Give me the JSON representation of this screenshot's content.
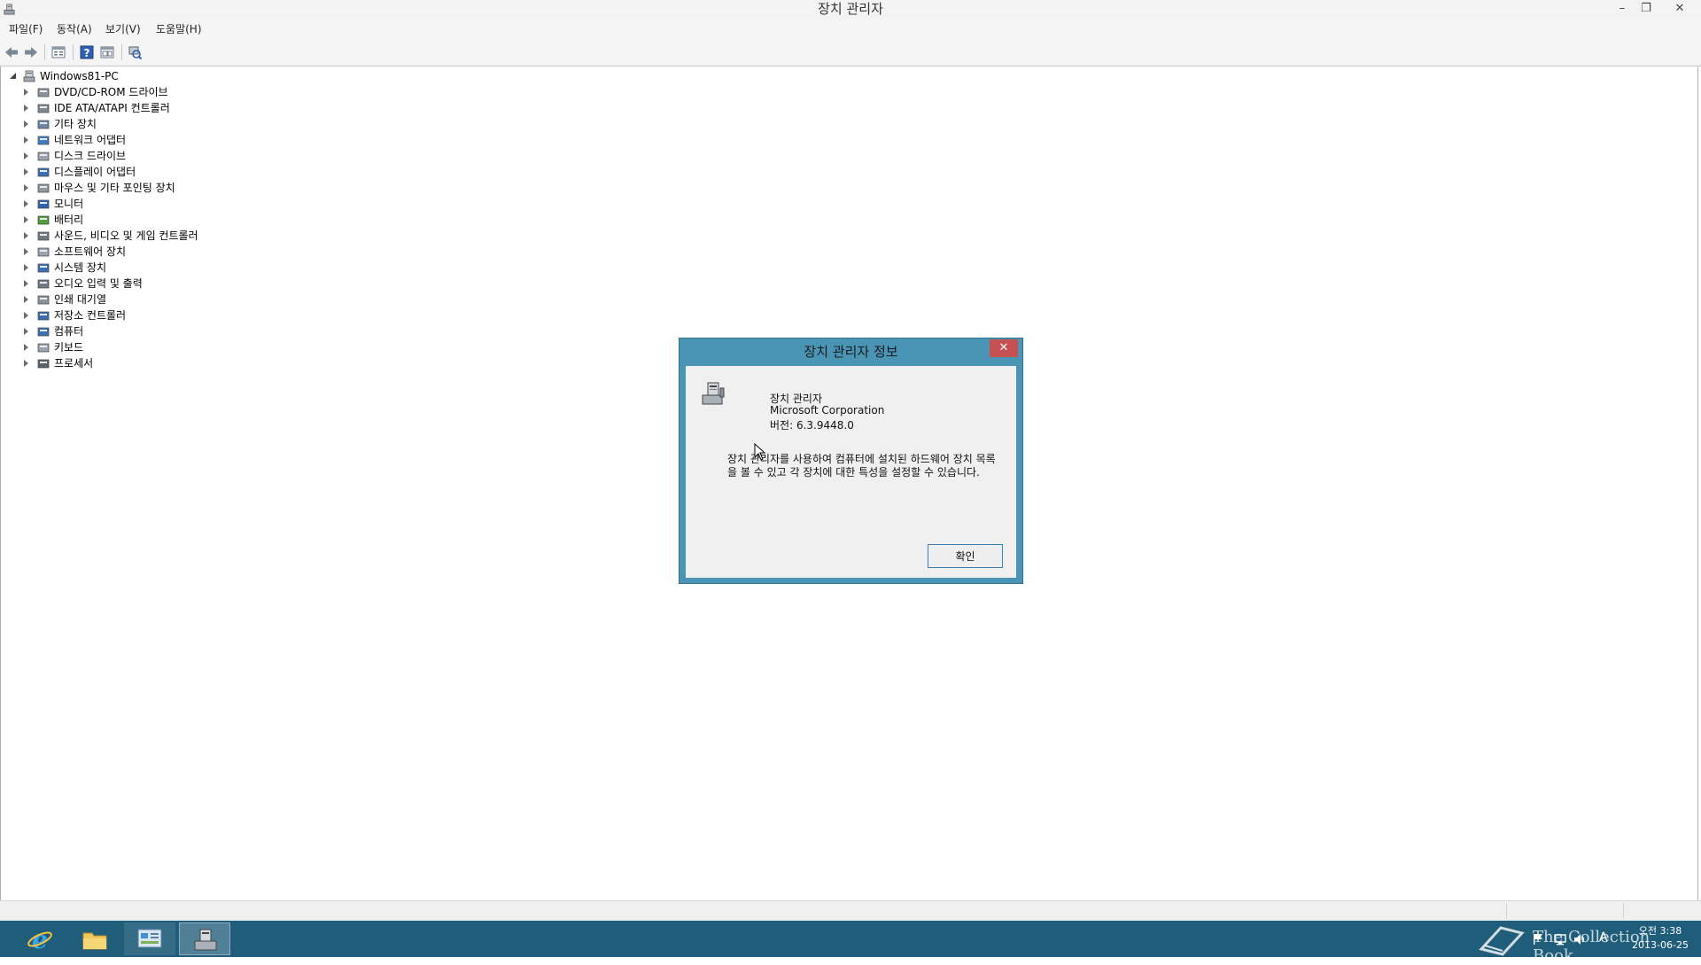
{
  "window": {
    "title": "장치 관리자",
    "controls": {
      "minimize": "–",
      "maximize": "❐",
      "close": "✕"
    }
  },
  "menu": [
    "파일(F)",
    "동작(A)",
    "보기(V)",
    "도움말(H)"
  ],
  "toolbar": {
    "icons": [
      "back-arrow-icon",
      "forward-arrow-icon",
      "properties-icon",
      "help-icon",
      "view-icon",
      "scan-hardware-icon"
    ]
  },
  "tree": {
    "root": {
      "label": "Windows81-PC",
      "icon": "computer-icon",
      "expanded": true
    },
    "items": [
      {
        "label": "DVD/CD-ROM 드라이브",
        "icon": "dvd-drive-icon"
      },
      {
        "label": "IDE ATA/ATAPI 컨트롤러",
        "icon": "ide-controller-icon"
      },
      {
        "label": "기타 장치",
        "icon": "unknown-device-icon"
      },
      {
        "label": "네트워크 어댑터",
        "icon": "network-adapter-icon"
      },
      {
        "label": "디스크 드라이브",
        "icon": "disk-drive-icon"
      },
      {
        "label": "디스플레이 어댑터",
        "icon": "display-adapter-icon"
      },
      {
        "label": "마우스 및 기타 포인팅 장치",
        "icon": "mouse-icon"
      },
      {
        "label": "모니터",
        "icon": "monitor-icon"
      },
      {
        "label": "배터리",
        "icon": "battery-icon"
      },
      {
        "label": "사운드, 비디오 및 게임 컨트롤러",
        "icon": "sound-icon"
      },
      {
        "label": "소프트웨어 장치",
        "icon": "software-device-icon"
      },
      {
        "label": "시스템 장치",
        "icon": "system-device-icon"
      },
      {
        "label": "오디오 입력 및 출력",
        "icon": "audio-io-icon"
      },
      {
        "label": "인쇄 대기열",
        "icon": "printer-icon"
      },
      {
        "label": "저장소 컨트롤러",
        "icon": "storage-controller-icon"
      },
      {
        "label": "컴퓨터",
        "icon": "computer-icon"
      },
      {
        "label": "키보드",
        "icon": "keyboard-icon"
      },
      {
        "label": "프로세서",
        "icon": "processor-icon"
      }
    ]
  },
  "dialog": {
    "title": "장치 관리자 정보",
    "close": "✕",
    "app_name": "장치 관리자",
    "company": "Microsoft Corporation",
    "version": "버전: 6.3.9448.0",
    "description": "장치 관리자를 사용하여 컴퓨터에 설치된 하드웨어 장치 목록을 볼 수 있고 각 장치에 대한 특성을 설정할 수 있습니다.",
    "ok_label": "확인"
  },
  "taskbar": {
    "apps": [
      {
        "name": "internet-explorer",
        "icon": "ie-icon"
      },
      {
        "name": "file-explorer",
        "icon": "folder-icon"
      },
      {
        "name": "control-panel",
        "icon": "control-panel-icon"
      },
      {
        "name": "device-manager",
        "icon": "device-manager-icon"
      }
    ],
    "watermark": "The Collection Book",
    "tray_ime": "A",
    "clock_time": "오전 3:38",
    "clock_date": "2013-06-25"
  },
  "colors": {
    "taskbar": "#1f5d7a",
    "dialog_frame": "#4a94b6",
    "dialog_close": "#c75050"
  }
}
